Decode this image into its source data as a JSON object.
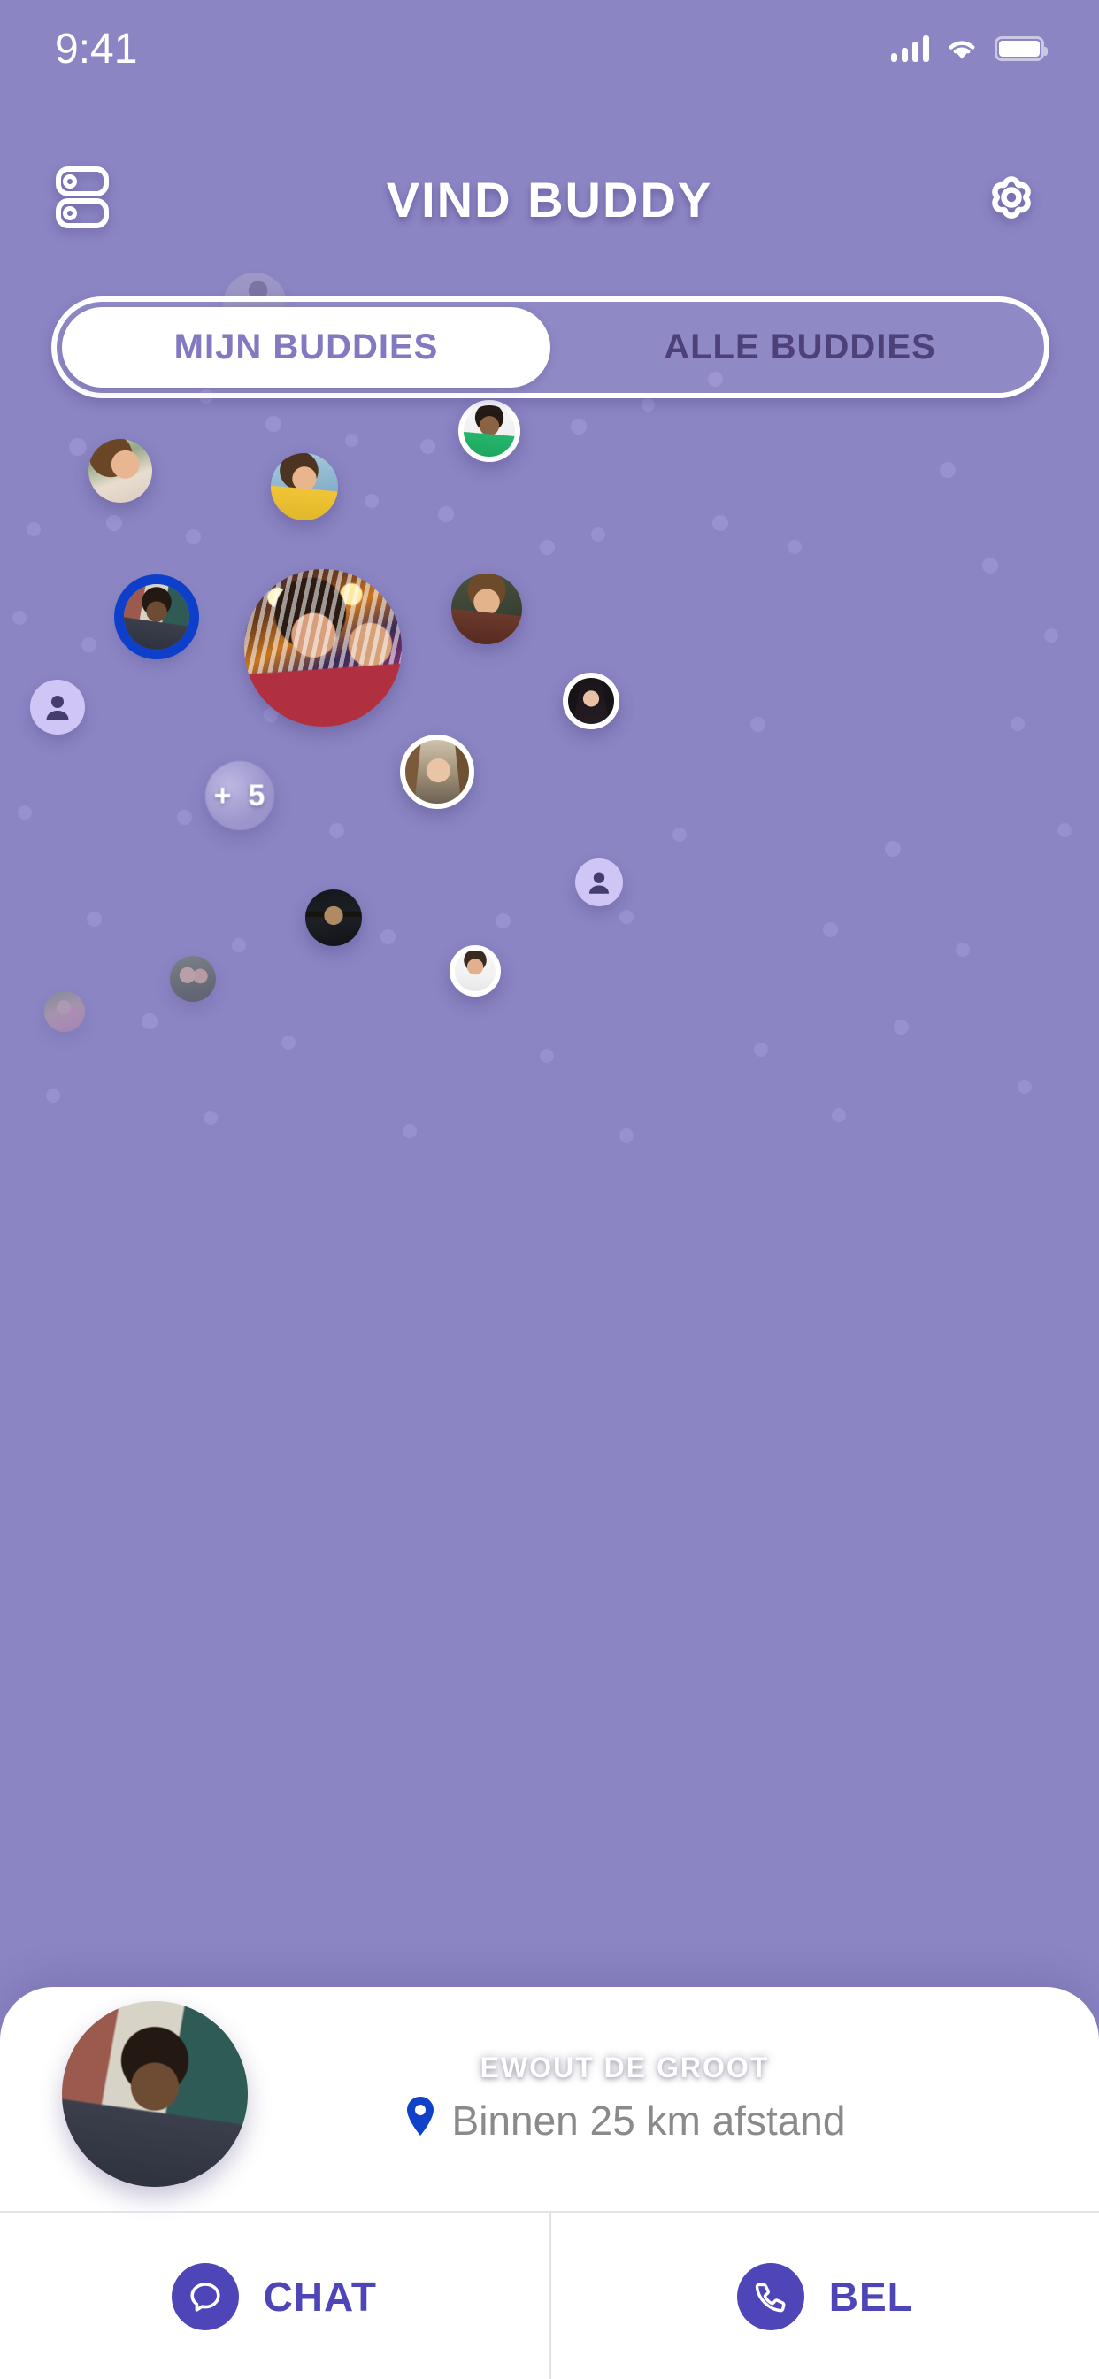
{
  "status_bar": {
    "time": "9:41",
    "signal_icon": "signal-bars-icon",
    "wifi_icon": "wifi-icon",
    "battery_icon": "battery-full-icon"
  },
  "header": {
    "title": "VIND BUDDY",
    "left_icon": "list-view-icon",
    "right_icon": "gear-icon"
  },
  "tabs": {
    "items": [
      {
        "label": "MIJN BUDDIES",
        "active": true
      },
      {
        "label": "ALLE BUDDIES",
        "active": false
      }
    ],
    "active_text_color": "#8279c0",
    "inactive_text_color": "#4e4179"
  },
  "map": {
    "background_color": "#8b85c4",
    "dot_color": "#a79fe0",
    "cluster": {
      "plus": "+",
      "count": "5",
      "label": "+ 5"
    },
    "selected_ring_color": "#0d3fcb",
    "placeholder_avatar_bg": "#cfc6f5",
    "placeholder_avatar_fg": "#453d6e"
  },
  "card": {
    "name": "EWOUT DE GROOT",
    "distance": "Binnen 25 km afstand",
    "pin_icon": "location-pin-icon",
    "pin_color": "#1141c9",
    "actions": [
      {
        "label": "CHAT",
        "icon": "chat-bubble-icon"
      },
      {
        "label": "BEL",
        "icon": "phone-icon"
      }
    ],
    "accent_color": "#4e45b8"
  }
}
